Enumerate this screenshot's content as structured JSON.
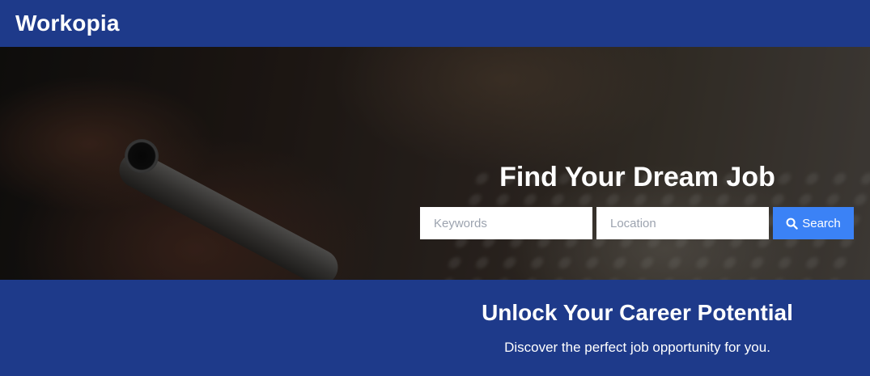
{
  "header": {
    "brand": "Workopia"
  },
  "hero": {
    "title": "Find Your Dream Job",
    "search": {
      "keywords_placeholder": "Keywords",
      "keywords_value": "",
      "location_placeholder": "Location",
      "location_value": "",
      "button_label": "Search",
      "button_icon": "search-icon"
    }
  },
  "promo": {
    "title": "Unlock Your Career Potential",
    "subtitle": "Discover the perfect job opportunity for you."
  },
  "colors": {
    "brand_blue": "#1e3a8a",
    "button_blue": "#3b82f6",
    "text_white": "#ffffff"
  }
}
